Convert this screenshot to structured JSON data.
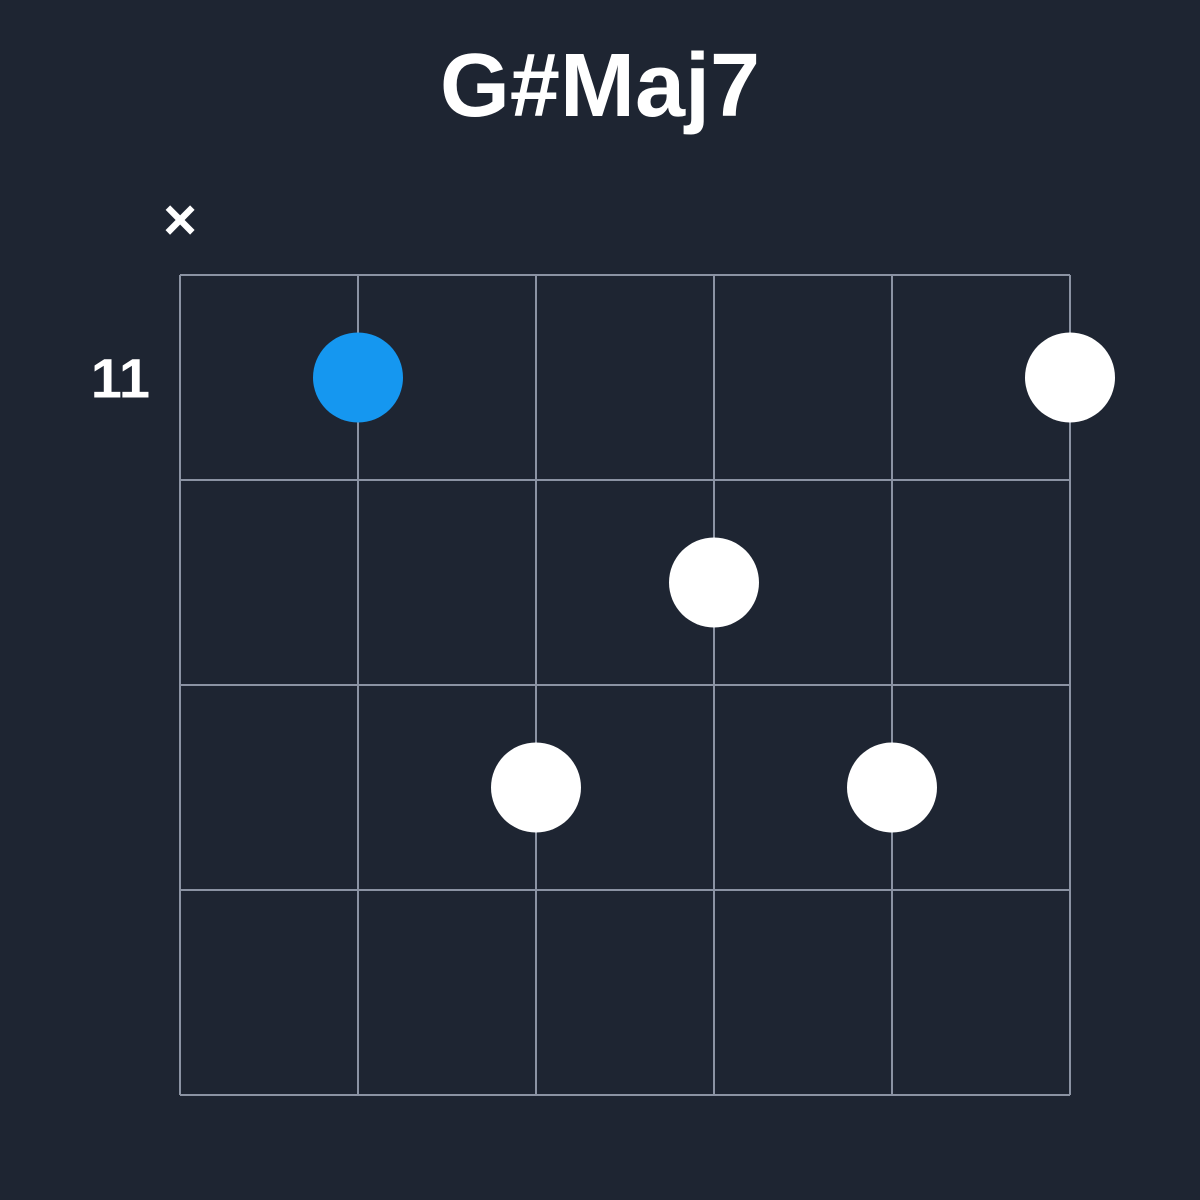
{
  "chord": {
    "name": "G#Maj7",
    "starting_fret": 11,
    "num_frets": 4,
    "num_strings": 6,
    "strings": [
      {
        "string": 1,
        "status": "muted"
      },
      {
        "string": 2,
        "status": "fretted",
        "fret": 1,
        "is_root": true
      },
      {
        "string": 3,
        "status": "fretted",
        "fret": 3,
        "is_root": false
      },
      {
        "string": 4,
        "status": "fretted",
        "fret": 2,
        "is_root": false
      },
      {
        "string": 5,
        "status": "fretted",
        "fret": 3,
        "is_root": false
      },
      {
        "string": 6,
        "status": "fretted",
        "fret": 1,
        "is_root": false
      }
    ]
  },
  "symbols": {
    "mute": "×"
  },
  "colors": {
    "background": "#1e2532",
    "grid": "#8b93a3",
    "dot": "#ffffff",
    "root_dot": "#1597f0",
    "text": "#ffffff"
  }
}
